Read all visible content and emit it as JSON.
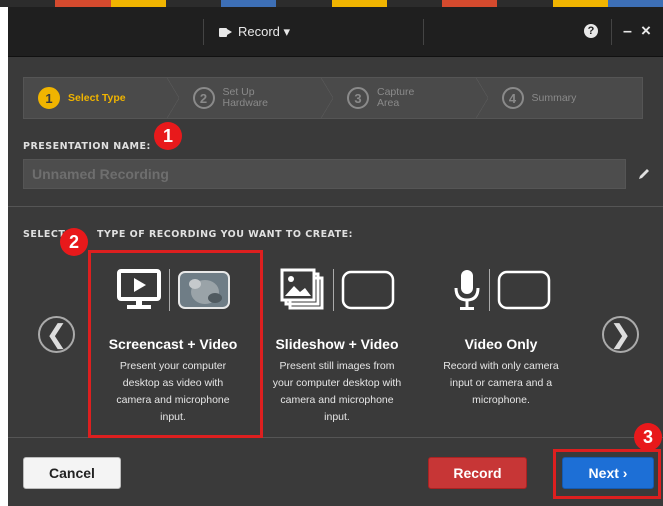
{
  "title_bar": {
    "record_menu_label": "Record ▾"
  },
  "steps": [
    {
      "number": "1",
      "label": "Select Type",
      "active": true
    },
    {
      "number": "2",
      "label": "Set Up Hardware",
      "active": false
    },
    {
      "number": "3",
      "label": "Capture Area",
      "active": false
    },
    {
      "number": "4",
      "label": "Summary",
      "active": false
    }
  ],
  "presentation": {
    "label": "PRESENTATION NAME:",
    "name_value": "Unnamed Recording"
  },
  "recording_type": {
    "label_start": "SELECT",
    "label_end": "TYPE OF RECORDING YOU WANT TO CREATE:",
    "options": [
      {
        "title": "Screencast + Video",
        "description": "Present your computer\ndesktop as video with\ncamera and microphone\ninput."
      },
      {
        "title": "Slideshow + Video",
        "description": "Present still images from\nyour computer desktop with\ncamera and microphone\ninput."
      },
      {
        "title": "Video Only",
        "description": "Record with only camera\ninput or camera and a\nmicrophone."
      }
    ]
  },
  "nav": {
    "prev_glyph": "❮",
    "next_glyph": "❯"
  },
  "footer": {
    "cancel_label": "Cancel",
    "record_label": "Record",
    "next_label": "Next ›"
  },
  "annotations": [
    "1",
    "2",
    "3"
  ],
  "colors": {
    "active_step": "#f0b400",
    "record_button": "#c73636",
    "next_button": "#1d6fd6",
    "annotation": "#e8191b"
  }
}
